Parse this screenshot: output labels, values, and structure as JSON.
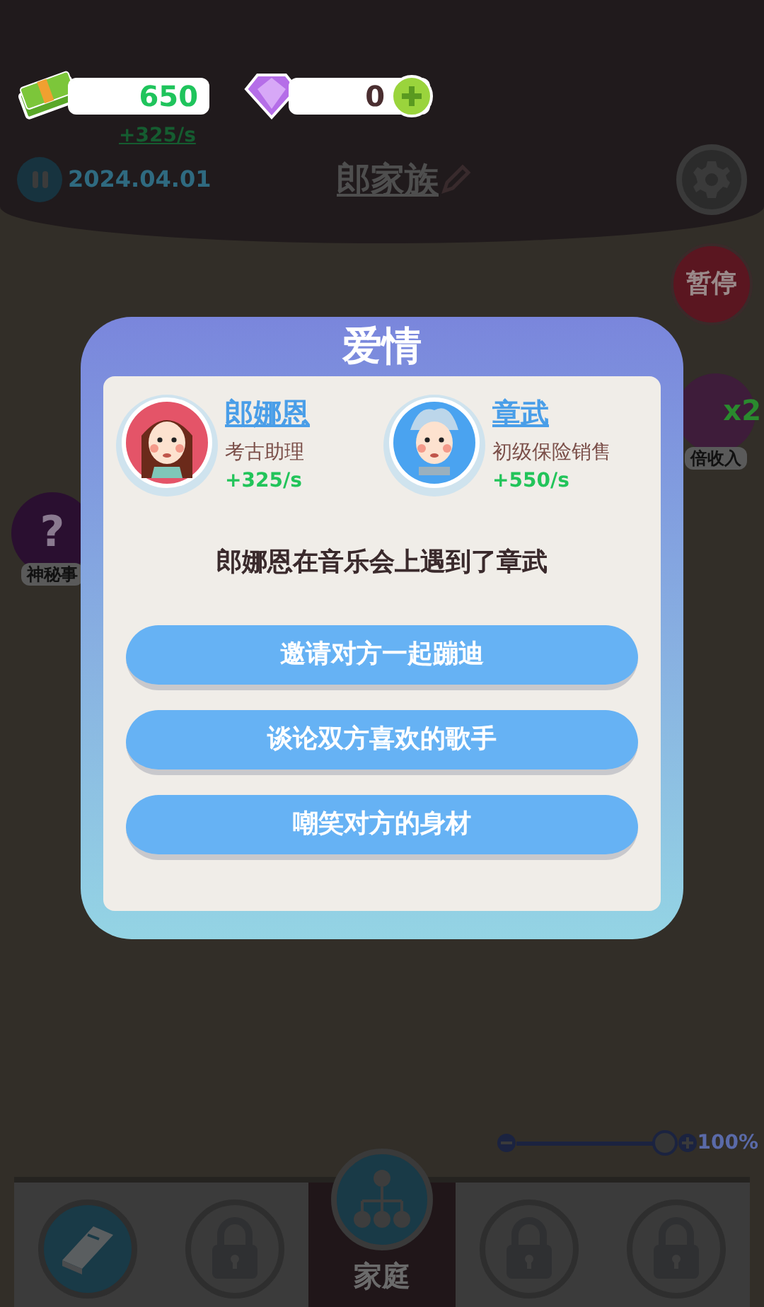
{
  "hud": {
    "money": "650",
    "rate": "+325/s",
    "gems": "0",
    "date": "2024.04.01",
    "family": "郎家族"
  },
  "side_buttons": [
    {
      "kind": "pause",
      "label": "暂停"
    },
    {
      "kind": "double",
      "label": "倍收入",
      "badge": "x2"
    },
    {
      "kind": "mystery",
      "symbol": "?",
      "label": "神秘事"
    }
  ],
  "dialog": {
    "title": "爱情",
    "people": [
      {
        "kind": "female",
        "name": "郎娜恩",
        "job": "考古助理",
        "income": "+325/s"
      },
      {
        "kind": "male",
        "name": "章武",
        "job": "初级保险销售",
        "income": "+550/s"
      }
    ],
    "message": "郎娜恩在音乐会上遇到了章武",
    "options": [
      "邀请对方一起蹦迪",
      "谈论双方喜欢的歌手",
      "嘲笑对方的身材"
    ]
  },
  "zoom": {
    "level": 1,
    "reading": "100%"
  },
  "nav": [
    {
      "kind": "book",
      "selected": false
    },
    {
      "kind": "locked",
      "selected": false
    },
    {
      "kind": "family",
      "label": "家庭",
      "selected": true
    },
    {
      "kind": "locked",
      "selected": false
    },
    {
      "kind": "locked",
      "selected": false
    }
  ]
}
